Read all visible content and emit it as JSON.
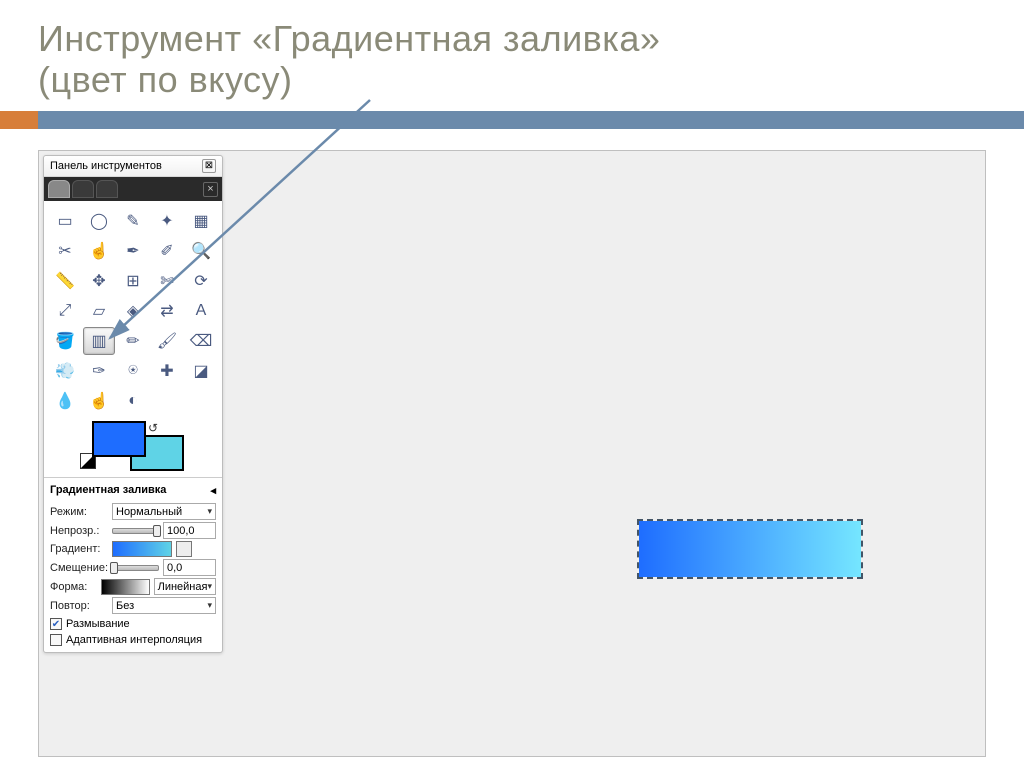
{
  "slide": {
    "title_line1": "Инструмент «Градиентная заливка»",
    "title_line2": "(цвет по вкусу)"
  },
  "toolbox": {
    "title": "Панель инструментов",
    "close": "⊠",
    "tab_close": "×",
    "tools": [
      {
        "name": "rect-select",
        "glyph": "▭"
      },
      {
        "name": "ellipse-select",
        "glyph": "◯"
      },
      {
        "name": "free-select",
        "glyph": "✎"
      },
      {
        "name": "fuzzy-select",
        "glyph": "✦"
      },
      {
        "name": "color-select",
        "glyph": "▦"
      },
      {
        "name": "scissors",
        "glyph": "✂"
      },
      {
        "name": "foreground-sel",
        "glyph": "☝"
      },
      {
        "name": "paths",
        "glyph": "✒"
      },
      {
        "name": "color-picker",
        "glyph": "✐"
      },
      {
        "name": "zoom",
        "glyph": "🔍"
      },
      {
        "name": "measure",
        "glyph": "📏"
      },
      {
        "name": "move",
        "glyph": "✥"
      },
      {
        "name": "align",
        "glyph": "⊞"
      },
      {
        "name": "crop",
        "glyph": "✄"
      },
      {
        "name": "rotate",
        "glyph": "⟳"
      },
      {
        "name": "scale",
        "glyph": "⤢"
      },
      {
        "name": "shear",
        "glyph": "▱"
      },
      {
        "name": "perspective",
        "glyph": "◈"
      },
      {
        "name": "flip",
        "glyph": "⇄"
      },
      {
        "name": "text",
        "glyph": "A"
      },
      {
        "name": "bucket-fill",
        "glyph": "🪣"
      },
      {
        "name": "gradient",
        "glyph": "▥",
        "selected": true
      },
      {
        "name": "pencil",
        "glyph": "✏"
      },
      {
        "name": "paintbrush",
        "glyph": "🖌"
      },
      {
        "name": "eraser",
        "glyph": "⌫"
      },
      {
        "name": "airbrush",
        "glyph": "💨"
      },
      {
        "name": "ink",
        "glyph": "✑"
      },
      {
        "name": "clone",
        "glyph": "⍟"
      },
      {
        "name": "heal",
        "glyph": "✚"
      },
      {
        "name": "perspective-clone",
        "glyph": "◪"
      },
      {
        "name": "blur",
        "glyph": "💧"
      },
      {
        "name": "smudge",
        "glyph": "☝"
      },
      {
        "name": "dodge-burn",
        "glyph": "◐"
      }
    ],
    "colors": {
      "foreground": "#1e6dff",
      "background": "#5fd3e6"
    }
  },
  "options": {
    "section_title": "Градиентная заливка",
    "collapse": "◂",
    "mode_label": "Режим:",
    "mode_value": "Нормальный",
    "opacity_label": "Непрозр.:",
    "opacity_value": "100,0",
    "gradient_label": "Градиент:",
    "offset_label": "Смещение:",
    "offset_value": "0,0",
    "shape_label": "Форма:",
    "shape_value": "Линейная",
    "repeat_label": "Повтор:",
    "repeat_value": "Без",
    "dither_label": "Размывание",
    "dither_checked": "✔",
    "adaptive_label": "Адаптивная интерполяция"
  }
}
